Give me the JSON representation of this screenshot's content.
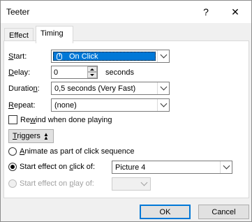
{
  "window": {
    "title": "Teeter",
    "help_glyph": "?",
    "close_glyph": "✕"
  },
  "tabs": [
    {
      "label": "Effect"
    },
    {
      "label": "Timing"
    }
  ],
  "timing": {
    "start": {
      "label_u": "S",
      "label_rest": "tart:",
      "value": "On Click"
    },
    "delay": {
      "label_u": "D",
      "label_rest": "elay:",
      "value": "0",
      "unit": "seconds"
    },
    "duration": {
      "label_pre": "Duratio",
      "label_u": "n",
      "label_rest": ":",
      "value": "0,5 seconds (Very Fast)"
    },
    "repeat": {
      "label_u": "R",
      "label_rest": "epeat:",
      "value": "(none)"
    },
    "rewind": {
      "label_pre": "Re",
      "label_u": "w",
      "label_rest": "ind when done playing",
      "checked": false
    },
    "triggers": {
      "label_u": "T",
      "label_rest": "riggers"
    },
    "animate_radio": {
      "label_u": "A",
      "label_rest": "nimate as part of click sequence",
      "checked": false
    },
    "click_radio": {
      "label_pre": "Start effect on ",
      "label_u": "c",
      "label_rest": "lick of:",
      "checked": true,
      "value": "Picture 4"
    },
    "play_radio": {
      "label_pre": "Start effect on ",
      "label_u": "p",
      "label_rest": "lay of:",
      "checked": false,
      "value": ""
    }
  },
  "footer": {
    "ok": "OK",
    "cancel": "Cancel"
  },
  "colors": {
    "accent": "#0078d7"
  }
}
